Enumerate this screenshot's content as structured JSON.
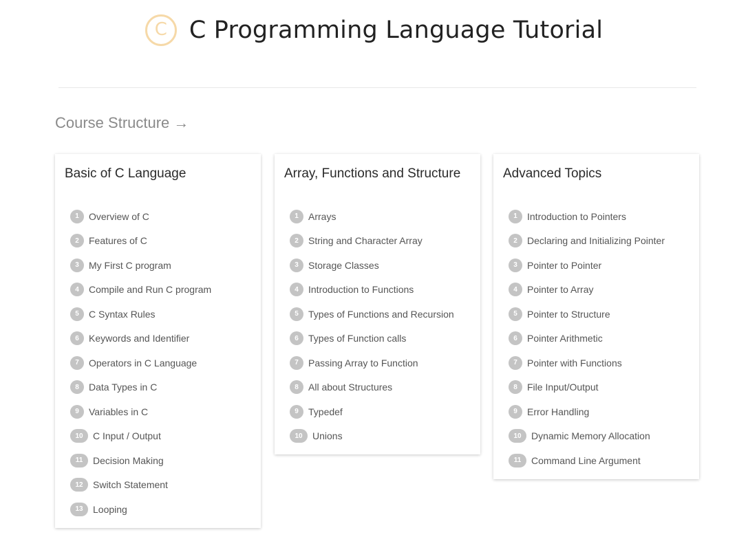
{
  "header": {
    "logo_glyph": "C",
    "title": "C Programming Language Tutorial"
  },
  "course": {
    "heading": "Course Structure →",
    "cards": [
      {
        "title": "Basic of C Language",
        "items": [
          {
            "num": "1",
            "label": "Overview of C"
          },
          {
            "num": "2",
            "label": "Features of C"
          },
          {
            "num": "3",
            "label": "My First C program"
          },
          {
            "num": "4",
            "label": "Compile and Run C program"
          },
          {
            "num": "5",
            "label": "C Syntax Rules"
          },
          {
            "num": "6",
            "label": "Keywords and Identifier"
          },
          {
            "num": "7",
            "label": "Operators in C Language"
          },
          {
            "num": "8",
            "label": "Data Types in C"
          },
          {
            "num": "9",
            "label": "Variables in C"
          },
          {
            "num": "10",
            "label": "C Input / Output"
          },
          {
            "num": "11",
            "label": "Decision Making"
          },
          {
            "num": "12",
            "label": "Switch Statement"
          },
          {
            "num": "13",
            "label": "Looping"
          }
        ]
      },
      {
        "title": "Array, Functions and Structure",
        "items": [
          {
            "num": "1",
            "label": "Arrays"
          },
          {
            "num": "2",
            "label": "String and Character Array"
          },
          {
            "num": "3",
            "label": "Storage Classes"
          },
          {
            "num": "4",
            "label": "Introduction to Functions"
          },
          {
            "num": "5",
            "label": "Types of Functions and Recursion"
          },
          {
            "num": "6",
            "label": "Types of Function calls"
          },
          {
            "num": "7",
            "label": "Passing Array to Function"
          },
          {
            "num": "8",
            "label": "All about Structures"
          },
          {
            "num": "9",
            "label": "Typedef"
          },
          {
            "num": "10",
            "label": "Unions"
          }
        ]
      },
      {
        "title": "Advanced Topics",
        "items": [
          {
            "num": "1",
            "label": "Introduction to Pointers"
          },
          {
            "num": "2",
            "label": "Declaring and Initializing Pointer"
          },
          {
            "num": "3",
            "label": "Pointer to Pointer"
          },
          {
            "num": "4",
            "label": "Pointer to Array"
          },
          {
            "num": "5",
            "label": "Pointer to Structure"
          },
          {
            "num": "6",
            "label": "Pointer Arithmetic"
          },
          {
            "num": "7",
            "label": "Pointer with Functions"
          },
          {
            "num": "8",
            "label": "File Input/Output"
          },
          {
            "num": "9",
            "label": "Error Handling"
          },
          {
            "num": "10",
            "label": "Dynamic Memory Allocation"
          },
          {
            "num": "11",
            "label": "Command Line Argument"
          }
        ]
      }
    ]
  },
  "colors": {
    "logo_accent": "#f6d9a8",
    "badge_bg": "#c4c4c4",
    "heading_gray": "#8a8a8a"
  }
}
